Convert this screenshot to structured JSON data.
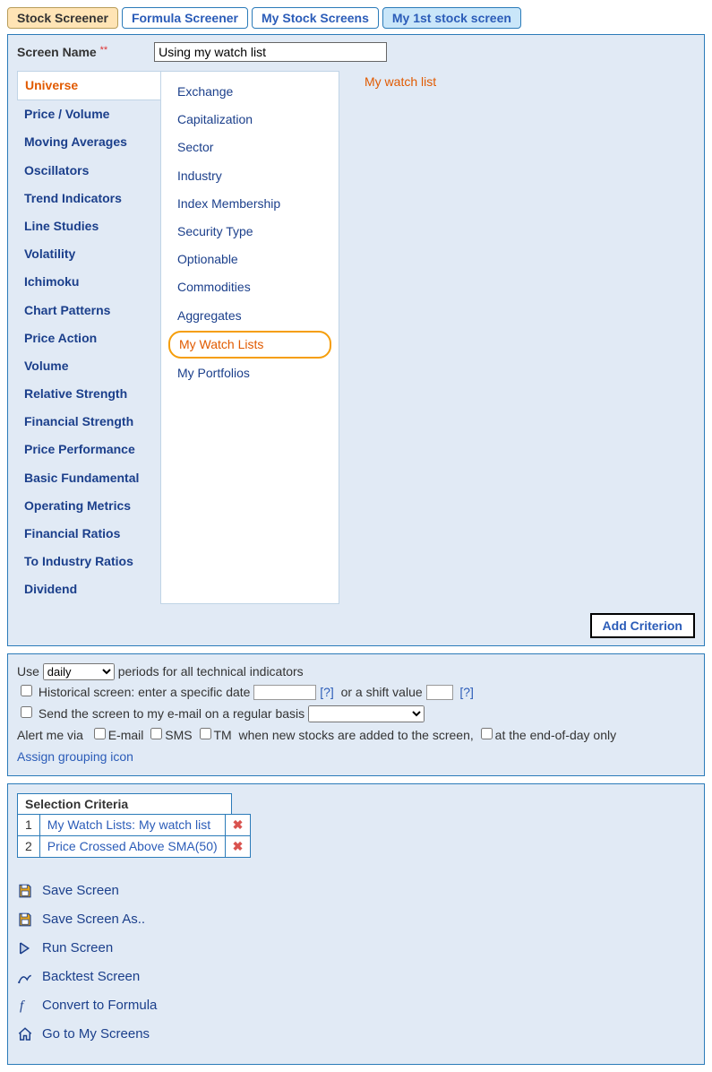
{
  "tabs": [
    {
      "label": "Stock Screener",
      "active": true
    },
    {
      "label": "Formula Screener",
      "active": false
    },
    {
      "label": "My Stock Screens",
      "active": false
    },
    {
      "label": "My 1st stock screen",
      "active": false
    }
  ],
  "screen_name": {
    "label": "Screen Name",
    "value": "Using my watch list"
  },
  "categories": [
    "Universe",
    "Price / Volume",
    "Moving Averages",
    "Oscillators",
    "Trend Indicators",
    "Line Studies",
    "Volatility",
    "Ichimoku",
    "Chart Patterns",
    "Price Action",
    "Volume",
    "Relative Strength",
    "Financial Strength",
    "Price Performance",
    "Basic Fundamental",
    "Operating Metrics",
    "Financial Ratios",
    "To Industry Ratios",
    "Dividend"
  ],
  "active_category_index": 0,
  "subitems": [
    "Exchange",
    "Capitalization",
    "Sector",
    "Industry",
    "Index Membership",
    "Security Type",
    "Optionable",
    "Commodities",
    "Aggregates",
    "My Watch Lists",
    "My Portfolios"
  ],
  "selected_sub_index": 9,
  "detail_title": "My watch list",
  "add_criterion_label": "Add Criterion",
  "settings": {
    "use_prefix": "Use",
    "use_suffix": "periods for all technical indicators",
    "period": "daily",
    "historical_label": "Historical screen: enter a specific date",
    "historical_date": "",
    "or_shift": "or a shift value",
    "shift_value": "",
    "help": "[?]",
    "send_email_label": "Send the screen to my e-mail on a regular basis",
    "alert_prefix": "Alert me via",
    "alert_email": "E-mail",
    "alert_sms": "SMS",
    "alert_tm": "TM",
    "alert_mid": "when new stocks are added to the screen,",
    "alert_eod": "at the end-of-day only",
    "assign_icon": "Assign grouping icon"
  },
  "criteria": {
    "header": "Selection Criteria",
    "rows": [
      {
        "n": "1",
        "text": "My Watch Lists: My watch list"
      },
      {
        "n": "2",
        "text": "Price Crossed Above SMA(50)"
      }
    ]
  },
  "actions": {
    "save": "Save Screen",
    "save_as": "Save Screen As..",
    "run": "Run Screen",
    "backtest": "Backtest Screen",
    "convert": "Convert to Formula",
    "goto": "Go to My Screens"
  }
}
